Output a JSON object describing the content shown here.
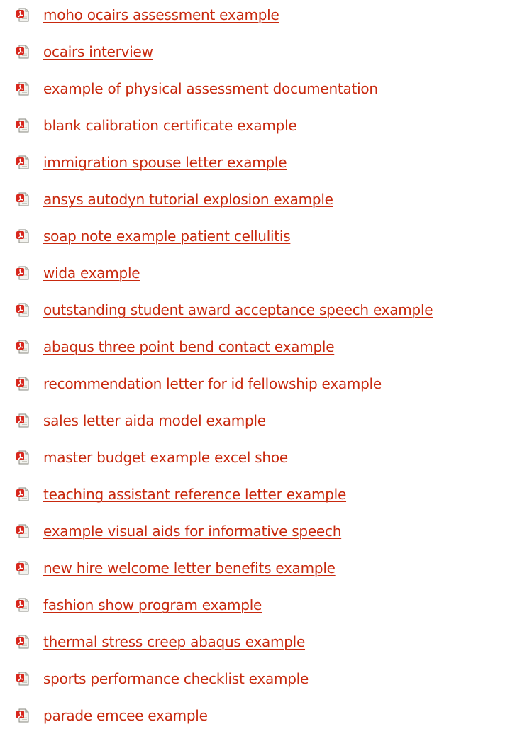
{
  "icon": {
    "name": "pdf-file-icon",
    "colors": {
      "badge": "#d7261c",
      "page": "#f2f2ee",
      "fold": "#c9c9c0",
      "outline": "#8a8a80"
    }
  },
  "link_color": "#c8290e",
  "links": [
    {
      "label": "moho ocairs assessment example"
    },
    {
      "label": "ocairs interview"
    },
    {
      "label": "example of physical assessment documentation"
    },
    {
      "label": "blank calibration certificate example"
    },
    {
      "label": "immigration spouse letter example"
    },
    {
      "label": "ansys autodyn tutorial explosion example"
    },
    {
      "label": "soap note example patient cellulitis"
    },
    {
      "label": "wida example"
    },
    {
      "label": "outstanding student award acceptance speech example"
    },
    {
      "label": "abaqus three point bend contact example"
    },
    {
      "label": "recommendation letter for id fellowship example"
    },
    {
      "label": "sales letter aida model example"
    },
    {
      "label": "master budget example excel shoe"
    },
    {
      "label": "teaching assistant reference letter example"
    },
    {
      "label": "example visual aids for informative speech"
    },
    {
      "label": "new hire welcome letter benefits example"
    },
    {
      "label": "fashion show program example"
    },
    {
      "label": "thermal stress creep abaqus example"
    },
    {
      "label": "sports performance checklist example"
    },
    {
      "label": "parade emcee example"
    }
  ]
}
